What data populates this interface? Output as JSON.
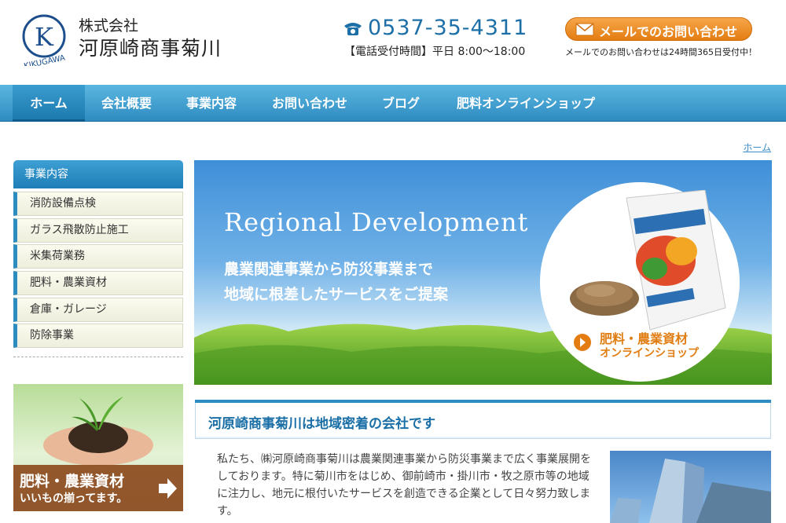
{
  "header": {
    "logo_letter": "K",
    "logo_ring_text": "KIKUGAWA",
    "company_type": "株式会社",
    "company_name": "河原崎商事菊川",
    "phone_number": "0537-35-4311",
    "phone_hours": "【電話受付時間】平日 8:00〜18:00",
    "mail_button_label": "メールでのお問い合わせ",
    "mail_note": "メールでのお問い合わせは24時間365日受付中！"
  },
  "nav": {
    "items": [
      {
        "label": "ホーム"
      },
      {
        "label": "会社概要"
      },
      {
        "label": "事業内容"
      },
      {
        "label": "お問い合わせ"
      },
      {
        "label": "ブログ"
      },
      {
        "label": "肥料オンラインショップ"
      }
    ]
  },
  "breadcrumb": "ホーム",
  "sidebar": {
    "heading": "事業内容",
    "items": [
      {
        "label": "消防設備点検"
      },
      {
        "label": "ガラス飛散防止施工"
      },
      {
        "label": "米集荷業務"
      },
      {
        "label": "肥料・農業資材"
      },
      {
        "label": "倉庫・ガレージ"
      },
      {
        "label": "防除事業"
      }
    ],
    "banner_line1": "肥料・農業資材",
    "banner_line2": "いいもの揃ってます。"
  },
  "hero": {
    "title": "Regional Development",
    "subtitle_line1": "農業関連事業から防災事業まで",
    "subtitle_line2": "地域に根差したサービスをご提案",
    "shop_line1": "肥料・農業資材",
    "shop_line2": "オンラインショップ"
  },
  "main": {
    "section_title": "河原崎商事菊川は地域密着の会社です",
    "intro_text": "私たち、㈱河原崎商事菊川は農業関連事業から防災事業まで広く事業展開をしております。特に菊川市をはじめ、御前崎市・掛川市・牧之原市等の地域に注力し、地元に根付いたサービスを創造できる企業として日々努力致します。"
  },
  "colors": {
    "brand_blue": "#2f8cc1",
    "accent_orange": "#e37d12"
  },
  "icons": {
    "phone": "phone-icon",
    "mail": "mail-icon",
    "arrow": "arrow-right-icon"
  }
}
